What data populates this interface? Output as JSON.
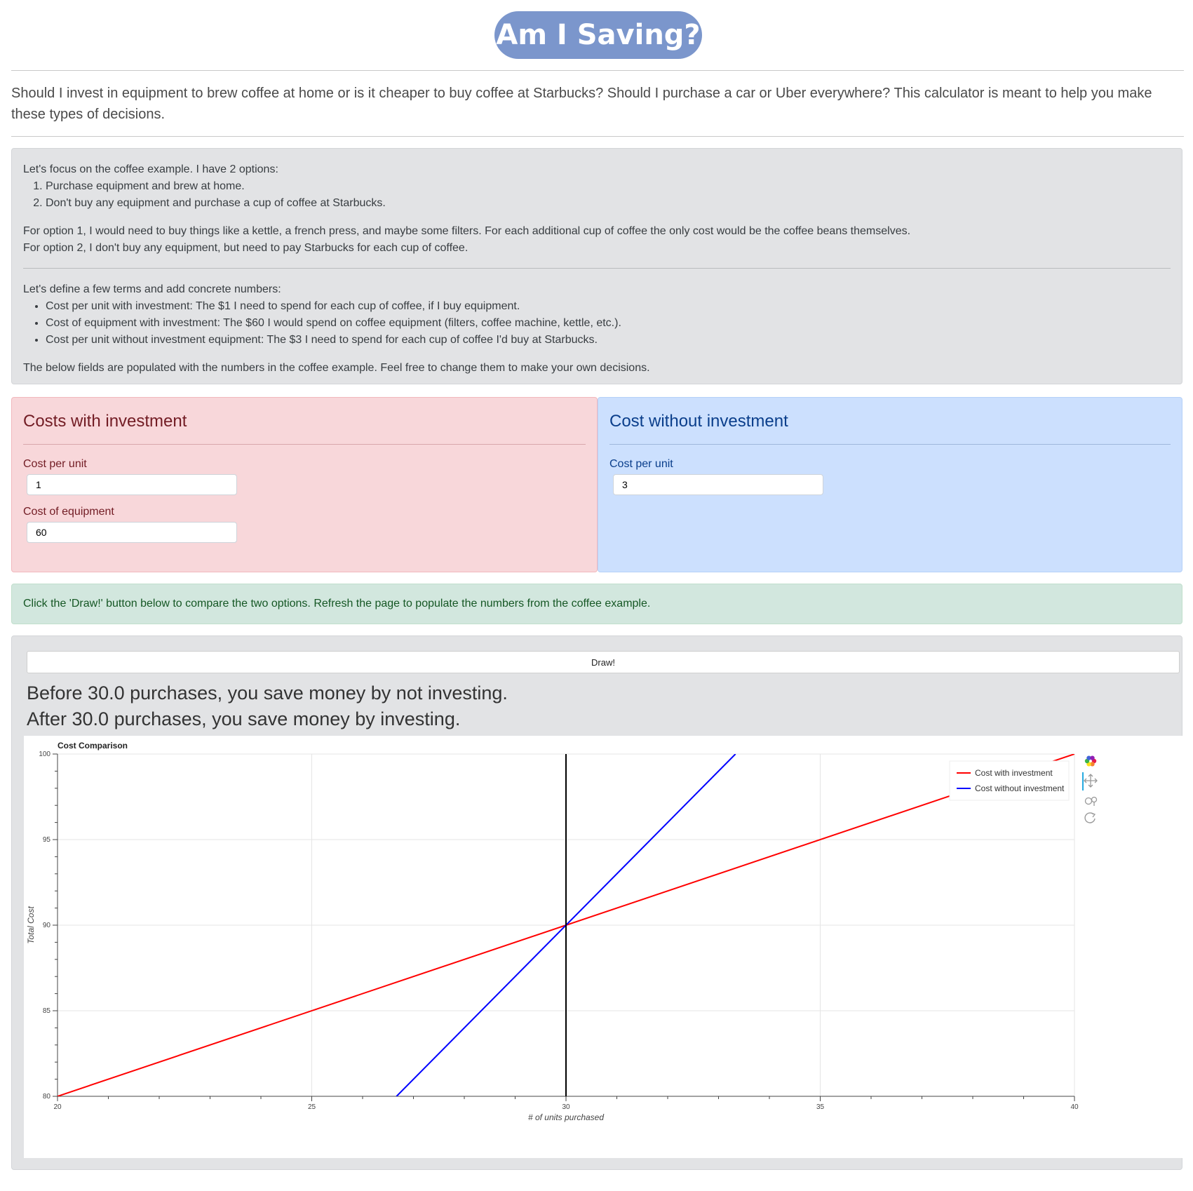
{
  "header": {
    "title": "Am I Saving?"
  },
  "intro": "Should I invest in equipment to brew coffee at home or is it cheaper to buy coffee at Starbucks? Should I purchase a car or Uber everywhere? This calculator is meant to help you make these types of decisions.",
  "explainer": {
    "opening": "Let's focus on the coffee example. I have 2 options:",
    "options": [
      "Purchase equipment and brew at home.",
      "Don't buy any equipment and purchase a cup of coffee at Starbucks."
    ],
    "option1_detail": "For option 1, I would need to buy things like a kettle, a french press, and maybe some filters. For each additional cup of coffee the only cost would be the coffee beans themselves.",
    "option2_detail": "For option 2, I don't buy any equipment, but need to pay Starbucks for each cup of coffee.",
    "terms_intro": "Let's define a few terms and add concrete numbers:",
    "terms": [
      "Cost per unit with investment: The $1 I need to spend for each cup of coffee, if I buy equipment.",
      "Cost of equipment with investment: The $60 I would spend on coffee equipment (filters, coffee machine, kettle, etc.).",
      "Cost per unit without investment equipment: The $3 I need to spend for each cup of coffee I'd buy at Starbucks."
    ],
    "fields_note": "The below fields are populated with the numbers in the coffee example. Feel free to change them to make your own decisions."
  },
  "with_investment": {
    "heading": "Costs with investment",
    "cost_per_unit_label": "Cost per unit",
    "cost_per_unit_value": "1",
    "equipment_label": "Cost of equipment",
    "equipment_value": "60"
  },
  "without_investment": {
    "heading": "Cost without investment",
    "cost_per_unit_label": "Cost per unit",
    "cost_per_unit_value": "3"
  },
  "hint": "Click the 'Draw!' button below to compare the two options. Refresh the page to populate the numbers from the coffee example.",
  "draw": {
    "button_label": "Draw!",
    "result_before": "Before 30.0 purchases, you save money by not investing.",
    "result_after": "After 30.0 purchases, you save money by investing."
  },
  "colors": {
    "with_investment": "#ff0000",
    "without_investment": "#0000ff",
    "breakeven": "#000000",
    "title_pill": "#7b96cc"
  },
  "chart_data": {
    "type": "line",
    "title": "Cost Comparison",
    "xlabel": "# of units purchased",
    "ylabel": "Total Cost",
    "xlim": [
      20,
      40
    ],
    "ylim": [
      80,
      100
    ],
    "xticks": [
      20,
      25,
      30,
      35,
      40
    ],
    "yticks": [
      80,
      85,
      90,
      95,
      100
    ],
    "grid": true,
    "legend_position": "top-right",
    "breakeven_x": 30,
    "series": [
      {
        "name": "Cost with investment",
        "color": "#ff0000",
        "x": [
          20,
          40
        ],
        "y": [
          80,
          100
        ]
      },
      {
        "name": "Cost without investment",
        "color": "#0000ff",
        "x": [
          26.667,
          33.333
        ],
        "y": [
          80,
          100
        ]
      }
    ],
    "toolbar_icons": [
      "bokeh-logo-icon",
      "pan-icon",
      "wheel-zoom-icon",
      "reset-icon"
    ]
  }
}
